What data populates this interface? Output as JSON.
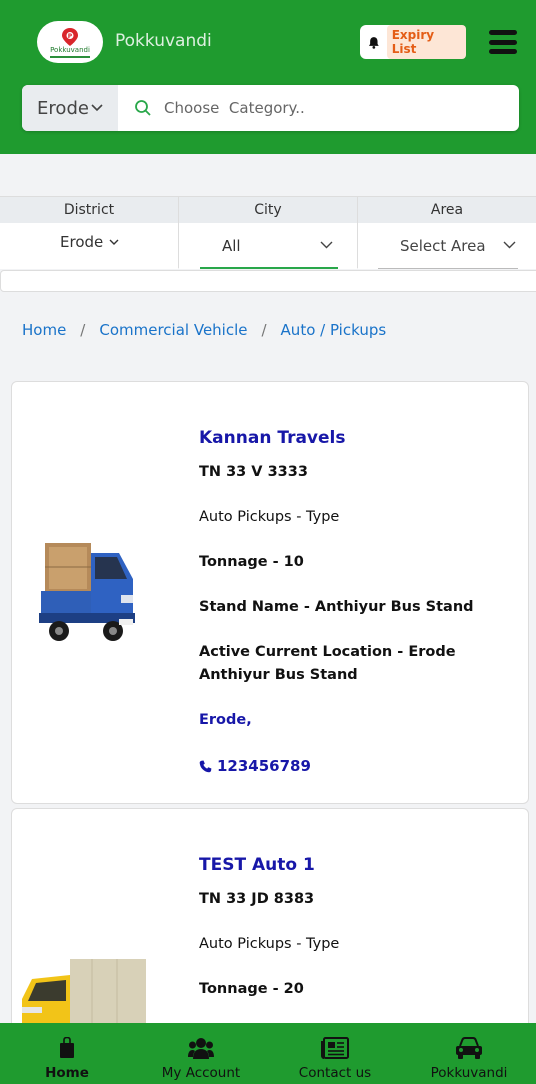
{
  "header": {
    "logo_text": "Pokkuvandi",
    "brand": "Pokkuvandi",
    "expiry_label": "Expiry List"
  },
  "search": {
    "district": "Erode",
    "placeholder": "Choose  Category.."
  },
  "filters": {
    "district_head": "District",
    "district_value": "Erode",
    "city_head": "City",
    "city_value": "All",
    "area_head": "Area",
    "area_value": "Select Area"
  },
  "breadcrumb": [
    "Home",
    "Commercial Vehicle",
    "Auto / Pickups"
  ],
  "listings": [
    {
      "title": "Kannan Travels",
      "reg_no": "TN 33 V 3333",
      "type": "Auto Pickups - Type",
      "tonnage": "Tonnage - 10",
      "stand": "Stand Name - Anthiyur Bus Stand",
      "location": "Active Current Location - Erode Anthiyur Bus Stand",
      "city": "Erode,",
      "phone": "123456789"
    },
    {
      "title": "TEST Auto 1",
      "reg_no": "TN 33 JD 8383",
      "type": "Auto Pickups - Type",
      "tonnage": "Tonnage - 20"
    }
  ],
  "bottom_nav": [
    {
      "label": "Home",
      "icon": "shopping-bag-icon",
      "active": true
    },
    {
      "label": "My Account",
      "icon": "users-icon",
      "active": false
    },
    {
      "label": "Contact us",
      "icon": "newspaper-icon",
      "active": false
    },
    {
      "label": "Pokkuvandi",
      "icon": "car-icon",
      "active": false
    }
  ],
  "colors": {
    "brand_green": "#1f9b2f",
    "link_blue": "#1a73c9",
    "title_blue": "#1717a8",
    "expiry_orange": "#e45d16"
  }
}
